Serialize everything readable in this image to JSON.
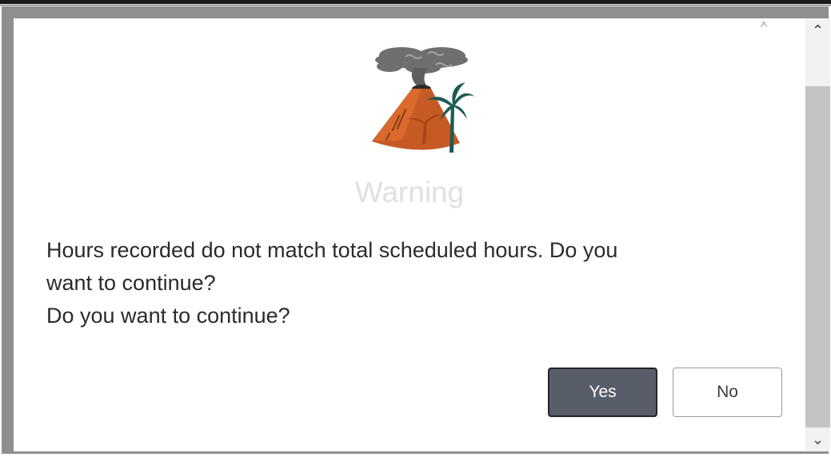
{
  "dialog": {
    "title": "Warning",
    "message_lines": [
      "Hours recorded do not match total scheduled hours. Do you",
      "want to continue?",
      "Do you want to continue?"
    ],
    "yes_label": "Yes",
    "no_label": "No",
    "close_glyph": "×",
    "illustration_icon": "volcano-icon"
  },
  "scrollbar": {
    "up_glyph": "⌃",
    "down_glyph": "⌄"
  },
  "colors": {
    "primary_button": "#585d6a",
    "title_text": "#e0e0e0",
    "volcano": "#c65a24"
  }
}
